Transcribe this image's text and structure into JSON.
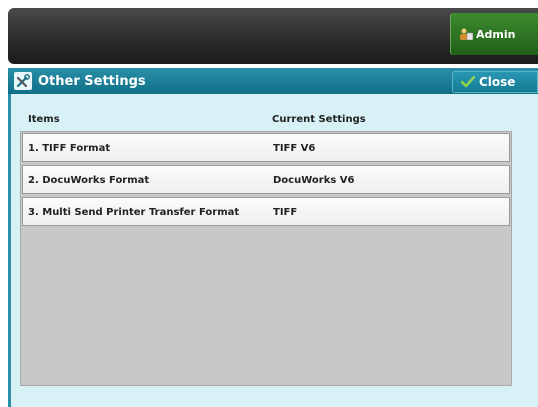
{
  "header": {
    "admin_label": "Admin"
  },
  "window": {
    "title": "Other Settings",
    "close_label": "Close"
  },
  "table": {
    "columns": [
      "Items",
      "Current Settings"
    ],
    "rows": [
      {
        "item": "1. TIFF Format",
        "value": "TIFF V6"
      },
      {
        "item": "2. DocuWorks Format",
        "value": "DocuWorks V6"
      },
      {
        "item": "3. Multi Send Printer Transfer Format",
        "value": "TIFF"
      }
    ]
  },
  "colors": {
    "title_bar": "#1a7f98",
    "window_bg": "#d7f1f6",
    "admin_button": "#2f7a22",
    "list_bg": "#c8c8c8"
  },
  "icons": {
    "admin": "admin-user-icon",
    "title": "tools-icon",
    "close": "checkmark-icon"
  }
}
